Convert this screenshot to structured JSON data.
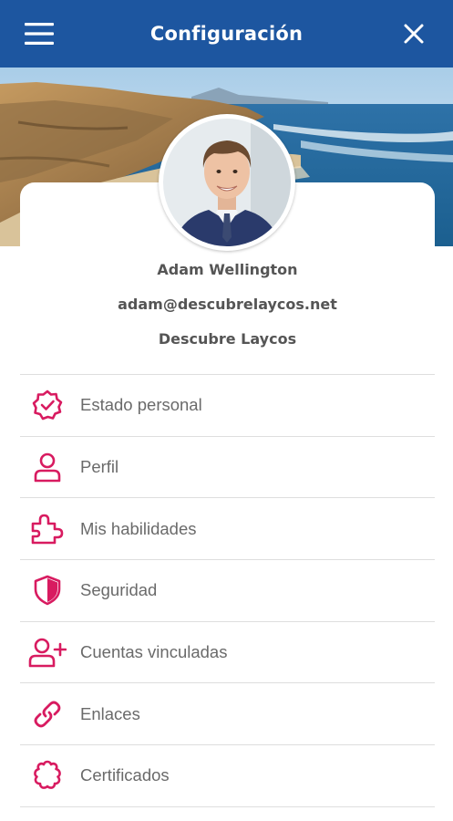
{
  "header": {
    "title": "Configuración",
    "background": "#1d56a0",
    "menu_icon": "hamburger-menu-icon",
    "close_icon": "close-icon"
  },
  "profile": {
    "name": "Adam Wellington",
    "email": "adam@descubrelaycos.net",
    "organization": "Descubre Laycos"
  },
  "accent_color": "#d81b60",
  "menu": {
    "items": [
      {
        "label": "Estado personal",
        "icon": "verified-badge-icon"
      },
      {
        "label": "Perfil",
        "icon": "person-icon"
      },
      {
        "label": "Mis habilidades",
        "icon": "puzzle-piece-icon"
      },
      {
        "label": "Seguridad",
        "icon": "shield-icon"
      },
      {
        "label": "Cuentas vinculadas",
        "icon": "person-add-icon"
      },
      {
        "label": "Enlaces",
        "icon": "link-icon"
      },
      {
        "label": "Certificados",
        "icon": "certificate-icon"
      }
    ]
  }
}
